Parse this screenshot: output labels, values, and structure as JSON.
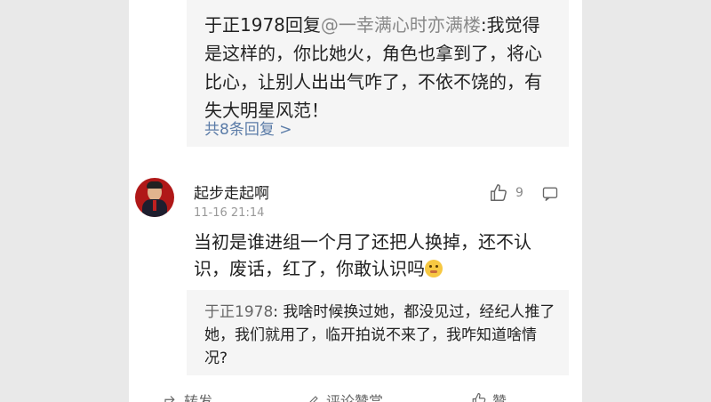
{
  "quote": {
    "author": "于正1978",
    "reply_word": "回复",
    "mention": "@一幸满心时亦满楼",
    "text": ":我觉得是这样的，你比她火，角色也拿到了，将心比心，让别人出出气咋了，不依不饶的，有失大明星风范！",
    "more_replies": "共8条回复 >"
  },
  "comment": {
    "username": "起步走起啊",
    "time": "11-16 21:14",
    "like_count": "9",
    "text": "当初是谁进组一个月了还把人换掉，还不认识，废话，红了，你敢认识吗"
  },
  "reply": {
    "author": "于正1978",
    "text": ": 我啥时候换过她，都没见过，经纪人推了她，我们就用了，临开拍说不来了，我咋知道啥情况?"
  },
  "actions": {
    "forward": "转发",
    "middle": "评论赞赏",
    "like": "赞"
  },
  "icons": [
    "thumbs-up-icon",
    "comment-icon",
    "emoji-icon",
    "forward-icon",
    "edit-icon"
  ]
}
